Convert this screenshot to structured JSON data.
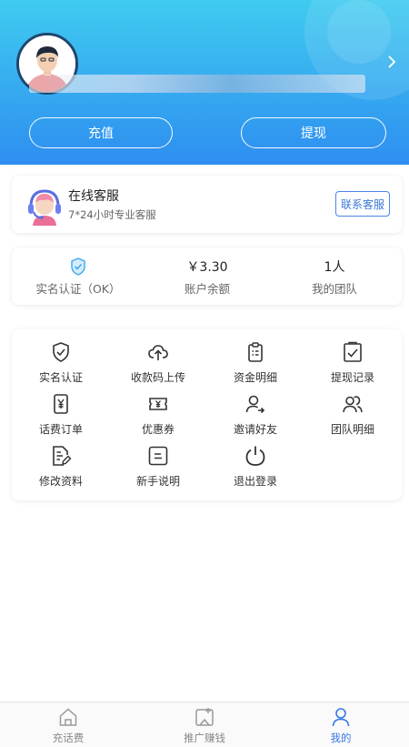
{
  "header": {
    "recharge_label": "充值",
    "withdraw_label": "提现"
  },
  "service": {
    "title": "在线客服",
    "subtitle": "7*24小时专业客服",
    "contact_label": "联系客服"
  },
  "stats": [
    {
      "value": "",
      "label": "实名认证（OK）",
      "icon": "shield-check-icon"
    },
    {
      "value": "￥3.30",
      "label": "账户余额"
    },
    {
      "value": "1人",
      "label": "我的团队"
    }
  ],
  "menu": [
    {
      "label": "实名认证",
      "icon": "shield-check-icon"
    },
    {
      "label": "收款码上传",
      "icon": "cloud-upload-icon"
    },
    {
      "label": "资金明细",
      "icon": "clipboard-list-icon"
    },
    {
      "label": "提现记录",
      "icon": "clipboard-check-icon"
    },
    {
      "label": "话费订单",
      "icon": "phone-yen-icon"
    },
    {
      "label": "优惠券",
      "icon": "coupon-icon"
    },
    {
      "label": "邀请好友",
      "icon": "user-invite-icon"
    },
    {
      "label": "团队明细",
      "icon": "team-icon"
    },
    {
      "label": "修改资料",
      "icon": "edit-document-icon"
    },
    {
      "label": "新手说明",
      "icon": "guide-icon"
    },
    {
      "label": "退出登录",
      "icon": "power-icon"
    }
  ],
  "tabs": [
    {
      "label": "充话费",
      "icon": "home-icon",
      "active": false
    },
    {
      "label": "推广赚钱",
      "icon": "share-icon",
      "active": false
    },
    {
      "label": "我的",
      "icon": "user-icon",
      "active": true
    }
  ],
  "colors": {
    "header_top": "#3fcbf0",
    "header_bottom": "#2e8ef0",
    "accent": "#3477e6",
    "icon_dark": "#333333",
    "shield_blue": "#3aa8f0"
  }
}
